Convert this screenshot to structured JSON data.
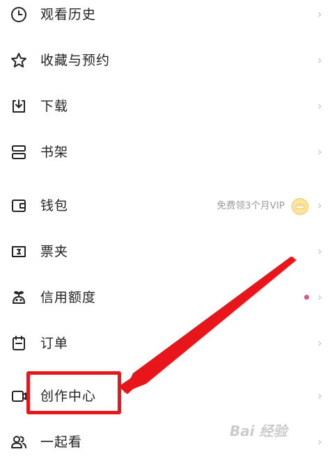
{
  "menu": {
    "items": [
      {
        "id": "history",
        "label": "观看历史",
        "icon": "clock-icon"
      },
      {
        "id": "favorites",
        "label": "收藏与预约",
        "icon": "star-icon"
      },
      {
        "id": "download",
        "label": "下载",
        "icon": "download-icon"
      },
      {
        "id": "bookshelf",
        "label": "书架",
        "icon": "bookshelf-icon"
      },
      {
        "id": "wallet",
        "label": "钱包",
        "icon": "wallet-icon",
        "extra": "免费领3个月VIP",
        "extra_icon": "vip-crown-icon"
      },
      {
        "id": "tickets",
        "label": "票夹",
        "icon": "ticket-icon"
      },
      {
        "id": "credit",
        "label": "信用额度",
        "icon": "credit-icon",
        "badge": "dot",
        "badge_color": "#ea4c89"
      },
      {
        "id": "orders",
        "label": "订单",
        "icon": "order-icon"
      },
      {
        "id": "creator",
        "label": "创作中心",
        "icon": "creator-icon"
      },
      {
        "id": "together",
        "label": "一起看",
        "icon": "users-icon"
      }
    ],
    "chevron": "›"
  },
  "annotation": {
    "highlight_color": "#e8151b"
  },
  "watermark": {
    "text": "Bai  经验"
  }
}
